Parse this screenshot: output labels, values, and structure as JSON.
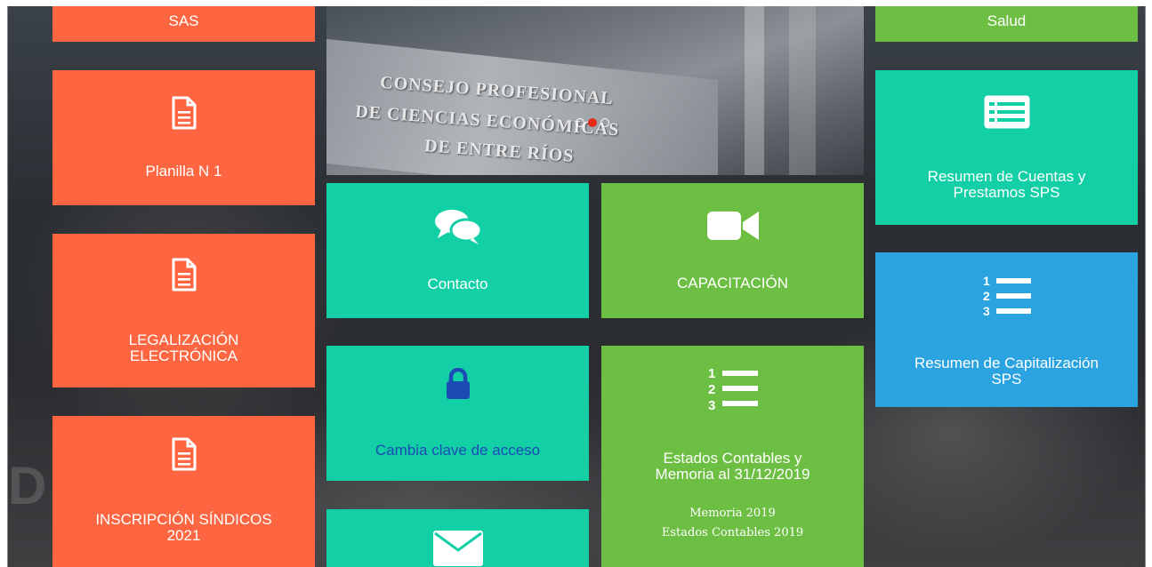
{
  "tiles": {
    "sas": "SAS",
    "planilla": "Planilla N 1",
    "legalizacion": "LEGALIZACIÓN\nELECTRÓNICA",
    "sindicos": "INSCRIPCIÓN SÍNDICOS\n2021",
    "contacto": "Contacto",
    "capacitacion": "CAPACITACIÓN",
    "cambia_clave": "Cambia clave de acceso",
    "estados_contables": "Estados Contables y\nMemoria al 31/12/2019",
    "memoria_link": "Memoria 2019",
    "estados_link": "Estados Contables 2019",
    "salud": "Salud",
    "resumen_cuentas": "Resumen de Cuentas y\nPrestamos SPS",
    "resumen_capitalizacion": "Resumen de Capitalización\nSPS"
  },
  "banner": {
    "sign_line1": "CONSEJO PROFESIONAL",
    "sign_line2": "DE CIENCIAS ECONÓMICAS",
    "sign_line3": "DE ENTRE RÍOS",
    "slides": 3,
    "active_slide": 2
  },
  "background_text": {
    "line1": "D    AS ECO"
  },
  "colors": {
    "orange": "#fd6641",
    "teal": "#12cfa6",
    "green": "#6cbf43",
    "blue": "#2ba3e0",
    "lock_blue": "#1b4bb5"
  },
  "icons": {
    "document": "document-icon",
    "chat": "chat-bubbles-icon",
    "video": "video-camera-icon",
    "lock": "lock-icon",
    "list_numbered": "numbered-list-icon",
    "card_list": "list-card-icon",
    "envelope": "envelope-icon"
  }
}
